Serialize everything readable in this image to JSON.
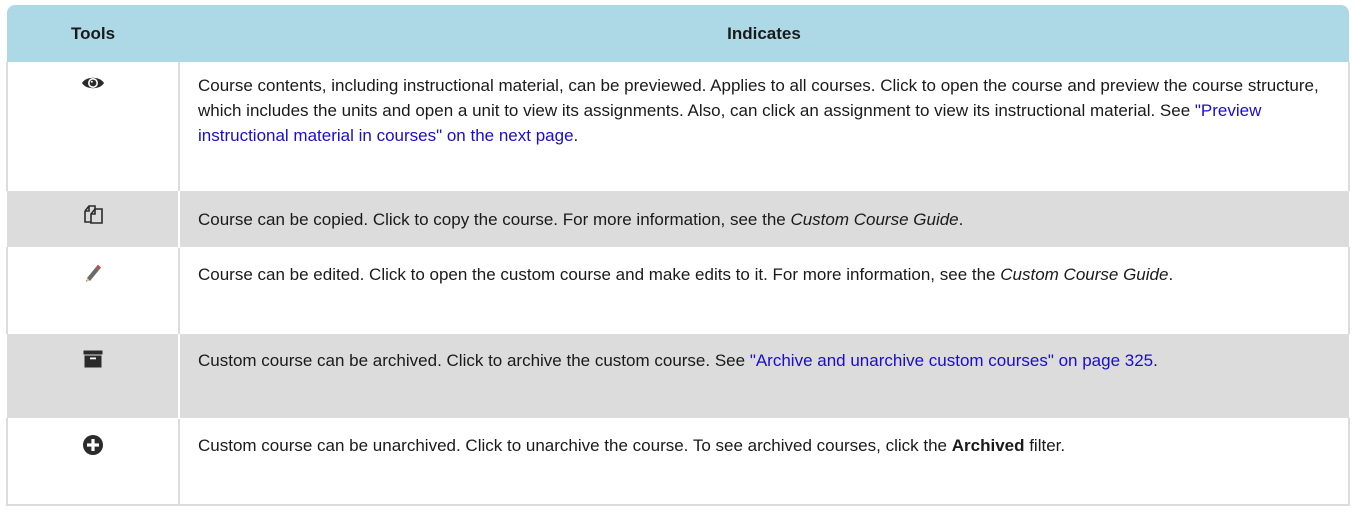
{
  "table": {
    "headers": {
      "tools": "Tools",
      "indicates": "Indicates"
    },
    "rows": [
      {
        "icon": "eye-icon",
        "text_before": "Course contents, including instructional material, can be previewed. Applies to all courses. Click to open the course and preview the course structure, which includes the units and open a unit to view its assignments. Also, can click an assignment to view its instructional material. See ",
        "link": "\"Preview instructional material in courses\" on the next page",
        "text_after": "."
      },
      {
        "icon": "copy-icon",
        "text_before": "Course can be copied. Click to copy the course. For more information, see the ",
        "ref": "Custom Course Guide",
        "text_after": "."
      },
      {
        "icon": "pencil-icon",
        "text_before": "Course can be edited. Click to open the custom course and make edits to it. For more information, see the ",
        "ref": "Custom Course Guide",
        "text_after": "."
      },
      {
        "icon": "archive-icon",
        "text_before": "Custom course can be archived. Click to archive the custom course. See ",
        "link": "\"Archive and unarchive custom courses\" on page 325",
        "text_after": "."
      },
      {
        "icon": "plus-circle-icon",
        "text_before": "Custom course can be unarchived. Click to unarchive the course. To see archived courses, click the ",
        "strong": "Archived",
        "text_after": " filter."
      }
    ]
  },
  "colors": {
    "header_bg": "#add8e6",
    "row_alt_bg": "#dcdcdc",
    "link": "#1a0dcc"
  }
}
